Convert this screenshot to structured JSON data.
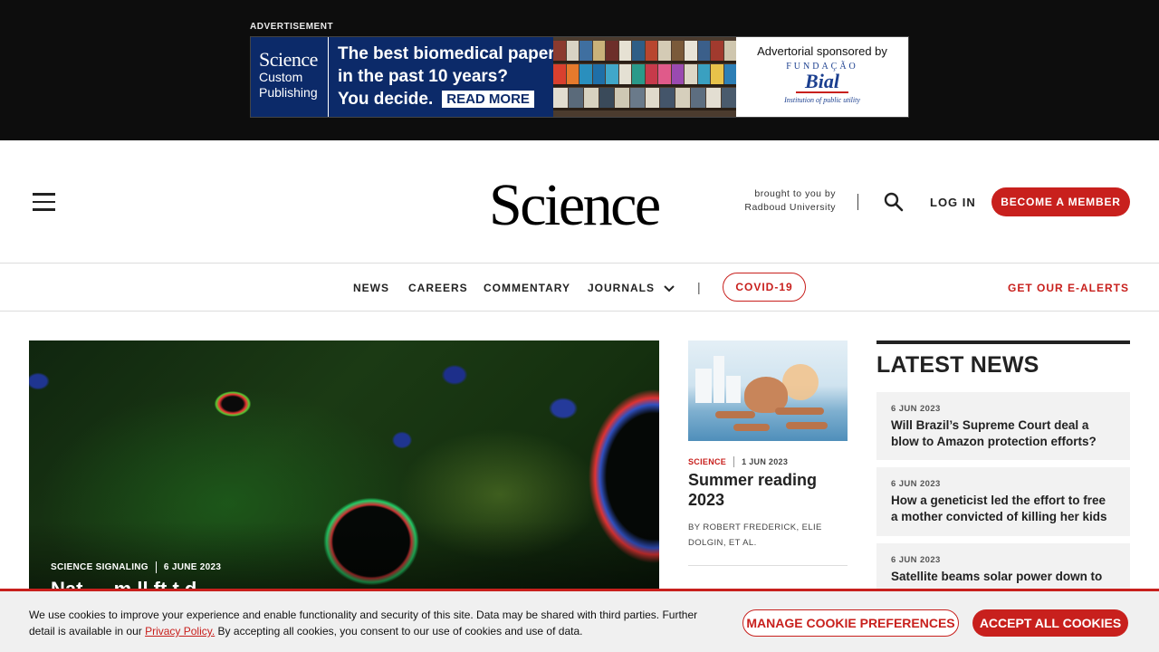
{
  "ad": {
    "label": "ADVERTISEMENT",
    "logo_line1": "Science",
    "logo_line2": "Custom",
    "logo_line3": "Publishing",
    "headline1": "The best biomedical paper",
    "headline2": "in the past 10 years?",
    "headline3": "You decide.",
    "cta": "READ MORE",
    "sponsor_text": "Advertorial sponsored by",
    "sponsor_fundacao": "FUNDAÇÃO",
    "sponsor_name": "Bial",
    "sponsor_tagline": "Institution of public utility"
  },
  "header": {
    "logo": "Science",
    "brought_line1": "brought to you by",
    "brought_line2": "Radboud University",
    "login": "LOG IN",
    "become_member": "BECOME A MEMBER",
    "icons": {
      "menu": "hamburger-menu-icon",
      "search": "search-icon"
    }
  },
  "nav": {
    "items": [
      {
        "label": "NEWS"
      },
      {
        "label": "CAREERS"
      },
      {
        "label": "COMMENTARY"
      },
      {
        "label": "JOURNALS",
        "dropdown": true
      }
    ],
    "separator": "|",
    "covid": "COVID-19",
    "ealerts": "GET OUR E-ALERTS"
  },
  "hero": {
    "section": "SCIENCE SIGNALING",
    "date": "6 JUNE 2023",
    "title_partial": "Nat … m ll ft  t d"
  },
  "feature": {
    "section": "SCIENCE",
    "date": "1 JUN 2023",
    "title": "Summer reading 2023",
    "byline": "BY ROBERT FREDERICK, ELIE DOLGIN, ET AL."
  },
  "latest_news": {
    "heading": "LATEST NEWS",
    "items": [
      {
        "date": "6 JUN 2023",
        "title": "Will Brazil’s Supreme Court deal a blow to Amazon protection efforts?"
      },
      {
        "date": "6 JUN 2023",
        "title": "How a geneticist led the effort to free a mother convicted of killing her kids"
      },
      {
        "date": "6 JUN 2023",
        "title": "Satellite beams solar power down to"
      }
    ]
  },
  "cookie": {
    "text_before": "We use cookies to improve your experience and enable functionality and security of this site. Data may be shared with third parties. Further detail is available in our ",
    "link": "Privacy Policy.",
    "text_after": " By accepting all cookies, you consent to our use of cookies and use of data.",
    "manage": "MANAGE COOKIE PREFERENCES",
    "accept": "ACCEPT ALL COOKIES"
  },
  "colors": {
    "accent": "#c8201d",
    "ad_navy": "#0c2a69",
    "ad_band": "#0d0d0d"
  }
}
